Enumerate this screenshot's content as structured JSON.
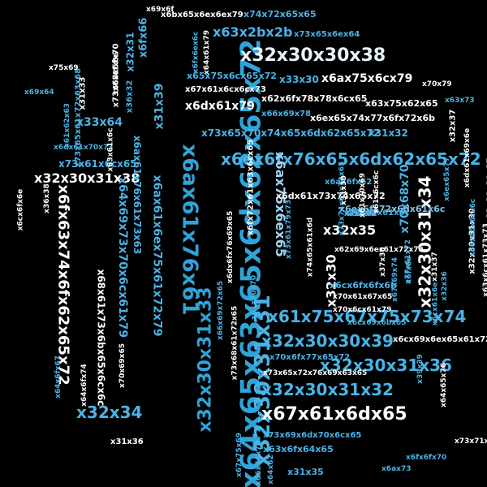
{
  "words": [
    {
      "text": "x64x65x63x65x6dx62x65x72",
      "color": "#2fa4d9"
    },
    {
      "text": "x6ax61x76x61",
      "color": "#2fa4d9"
    },
    {
      "text": "x32x30x31x33",
      "color": "#2fa4d9"
    },
    {
      "text": "x32x30x31x31",
      "color": "#4ab3e6"
    },
    {
      "text": "x6ex6fx76x65x6dx62x65x72",
      "color": "#4ab3e6"
    },
    {
      "text": "x32x30x30x38",
      "color": "#e8f4fb"
    },
    {
      "text": "x61x75x67x75x73x74",
      "color": "#4ab3e6"
    },
    {
      "text": "x32x30x30x39",
      "color": "#4ab3e6"
    },
    {
      "text": "x32x30x31x36",
      "color": "#4ab3e6"
    },
    {
      "text": "x32x30x31x32",
      "color": "#4ab3e6"
    },
    {
      "text": "x67x61x6dx65",
      "color": "#ffffff"
    },
    {
      "text": "x6fx63x74x6fx62x65x72",
      "color": "#ffffff"
    },
    {
      "text": "x32x30x31x34",
      "color": "#ffffff"
    },
    {
      "text": "x32x34",
      "color": "#4ab3e6"
    },
    {
      "text": "x63x2bx2b",
      "color": "#4ab3e6"
    },
    {
      "text": "x32x30x31x38",
      "color": "#ffffff"
    },
    {
      "text": "x6ax61x6ex75x61x72x79",
      "color": "#4ab3e6"
    },
    {
      "text": "x64x69x73x70x6cx61x79",
      "color": "#4ab3e6"
    },
    {
      "text": "x6ax75x6ex65",
      "color": "#9fd3ee"
    },
    {
      "text": "x6dx61x79",
      "color": "#ffffff"
    },
    {
      "text": "x6ax75x6cx79",
      "color": "#ffffff"
    },
    {
      "text": "x32x35",
      "color": "#ffffff"
    },
    {
      "text": "x70x68x70",
      "color": "#4ab3e6"
    },
    {
      "text": "x32x30",
      "color": "#ffffff"
    },
    {
      "text": "x31x39",
      "color": "#4ab3e6"
    },
    {
      "text": "x33x64",
      "color": "#4ab3e6"
    },
    {
      "text": "x6ax61x76x61x73x63",
      "color": "#4ab3e6"
    },
    {
      "text": "x68x61x73x6bx65x6cx6c",
      "color": "#ffffff"
    },
    {
      "text": "x73x65x70x74x65x6dx62x65x72",
      "color": "#4ab3e6"
    },
    {
      "text": "x31x32",
      "color": "#4ab3e6"
    },
    {
      "text": "x6ex6fx72x6dx61x6c",
      "color": "#7cc3e8"
    },
    {
      "text": "x74x72x65x65",
      "color": "#4ab3e6"
    },
    {
      "text": "x6bx65x6ex6ex79",
      "color": "#ffffff"
    },
    {
      "text": "x73x65x6ex64",
      "color": "#4ab3e6"
    },
    {
      "text": "x65x75x6cx65x72",
      "color": "#4ab3e6"
    },
    {
      "text": "x33x30",
      "color": "#4ab3e6"
    },
    {
      "text": "x67x61x6cx6cx73",
      "color": "#ffffff"
    },
    {
      "text": "x62x6fx78x78x6cx65",
      "color": "#ffffff"
    },
    {
      "text": "x63x75x62x65",
      "color": "#ffffff"
    },
    {
      "text": "x66x69x78",
      "color": "#4ab3e6"
    },
    {
      "text": "x6ex65x74x77x6fx72x6b",
      "color": "#ffffff"
    },
    {
      "text": "x32x37",
      "color": "#ffffff"
    },
    {
      "text": "x6fx66",
      "color": "#4ab3e6"
    },
    {
      "text": "x32x31",
      "color": "#4ab3e6"
    },
    {
      "text": "x36x32",
      "color": "#4ab3e6"
    },
    {
      "text": "x32x30x31x35",
      "color": "#4ab3e6"
    },
    {
      "text": "x32x30x31x30",
      "color": "#ffffff"
    },
    {
      "text": "x32x30x30x37",
      "color": "#ffffff"
    },
    {
      "text": "x6ax6fx62",
      "color": "#4ab3e6"
    },
    {
      "text": "x6dx61x73x74x65x72",
      "color": "#ffffff"
    },
    {
      "text": "x72x65x61x6c",
      "color": "#4ab3e6"
    },
    {
      "text": "x70x6fx77x65x72",
      "color": "#4ab3e6"
    },
    {
      "text": "x73x69x6dx70x6cx65",
      "color": "#4ab3e6"
    },
    {
      "text": "x63x6fx64x65",
      "color": "#4ab3e6"
    },
    {
      "text": "x6cx69x6ex65x61x72",
      "color": "#ffffff"
    },
    {
      "text": "x62x69x6ex61x72x79",
      "color": "#ffffff"
    },
    {
      "text": "x73x65x72x76x69x63x65",
      "color": "#ffffff"
    },
    {
      "text": "x6cx6fx6fx6b",
      "color": "#4ab3e6"
    },
    {
      "text": "x70x61x67x65",
      "color": "#ffffff"
    },
    {
      "text": "x73x61x6cx65",
      "color": "#4ab3e6"
    },
    {
      "text": "x6dx61x70x73",
      "color": "#4ab3e6"
    },
    {
      "text": "x36x38",
      "color": "#ffffff"
    },
    {
      "text": "x31x35",
      "color": "#4ab3e6"
    },
    {
      "text": "x64x65x76",
      "color": "#ffffff"
    },
    {
      "text": "x31x36",
      "color": "#ffffff"
    },
    {
      "text": "x32x32",
      "color": "#4ab3e6"
    },
    {
      "text": "x31x33",
      "color": "#ffffff"
    },
    {
      "text": "x73x65x61x72x63x68",
      "color": "#4ab3e6"
    },
    {
      "text": "x73x68x6fx70",
      "color": "#ffffff"
    },
    {
      "text": "x6cx6fx6e",
      "color": "#ffffff"
    },
    {
      "text": "x66x6fx6e",
      "color": "#ffffff"
    },
    {
      "text": "x6ex65x77",
      "color": "#4ab3e6"
    },
    {
      "text": "x6dx61x69x6e",
      "color": "#ffffff"
    },
    {
      "text": "x68x65x6cx6c",
      "color": "#4ab3e6"
    },
    {
      "text": "x6fx6e",
      "color": "#4ab3e6"
    },
    {
      "text": "x63x6cx61x73x73",
      "color": "#ffffff"
    },
    {
      "text": "x70x6cx61x79",
      "color": "#ffffff"
    },
    {
      "text": "x6cx69x6bx65",
      "color": "#4ab3e6"
    },
    {
      "text": "x6fx72x61x63x6cx65",
      "color": "#ffffff"
    },
    {
      "text": "x32x33",
      "color": "#4ab3e6"
    },
    {
      "text": "x31x37",
      "color": "#ffffff"
    },
    {
      "text": "x32x36",
      "color": "#4ab3e6"
    },
    {
      "text": "x37x30",
      "color": "#ffffff"
    },
    {
      "text": "x31x34",
      "color": "#4ab3e6"
    },
    {
      "text": "x66x69x72x65",
      "color": "#4ab3e6"
    },
    {
      "text": "x73x68x61x72x65",
      "color": "#ffffff"
    },
    {
      "text": "x6dx6fx76x69x65",
      "color": "#ffffff"
    },
    {
      "text": "x61x70x70",
      "color": "#4ab3e6"
    },
    {
      "text": "x74x65x61x6d",
      "color": "#ffffff"
    },
    {
      "text": "x73x74x61x74x65",
      "color": "#4ab3e6"
    },
    {
      "text": "x73x61x79x73",
      "color": "#4ab3e6"
    },
    {
      "text": "x31x30",
      "color": "#ffffff"
    },
    {
      "text": "x61x70x69",
      "color": "#ffffff"
    },
    {
      "text": "x61x6cx6c",
      "color": "#ffffff"
    },
    {
      "text": "x67x69x74",
      "color": "#4ab3e6"
    },
    {
      "text": "x77x61x72",
      "color": "#4ab3e6"
    },
    {
      "text": "x6cx61x6e",
      "color": "#4ab3e6"
    },
    {
      "text": "x39x39",
      "color": "#4ab3e6"
    },
    {
      "text": "x64x61x79",
      "color": "#ffffff"
    },
    {
      "text": "x6fx6ex6c",
      "color": "#4ab3e6"
    },
    {
      "text": "x63x61x6c",
      "color": "#ffffff"
    },
    {
      "text": "x61x62x63",
      "color": "#4ab3e6"
    },
    {
      "text": "x70x69x65",
      "color": "#ffffff"
    },
    {
      "text": "x64x6fx67",
      "color": "#4ab3e6"
    },
    {
      "text": "x64x6fx74",
      "color": "#ffffff"
    },
    {
      "text": "x67x75x69",
      "color": "#4ab3e6"
    },
    {
      "text": "x66x74x70",
      "color": "#4ab3e6"
    },
    {
      "text": "x64x62",
      "color": "#4ab3e6"
    },
    {
      "text": "x73x71x6c",
      "color": "#ffffff"
    },
    {
      "text": "x6fx6fx70",
      "color": "#4ab3e6"
    },
    {
      "text": "x6ax73",
      "color": "#4ab3e6"
    },
    {
      "text": "x70x79",
      "color": "#ffffff"
    },
    {
      "text": "x63x73",
      "color": "#4ab3e6"
    },
    {
      "text": "x75x69",
      "color": "#ffffff"
    },
    {
      "text": "x69x64",
      "color": "#4ab3e6"
    },
    {
      "text": "x69x6f",
      "color": "#ffffff"
    }
  ]
}
